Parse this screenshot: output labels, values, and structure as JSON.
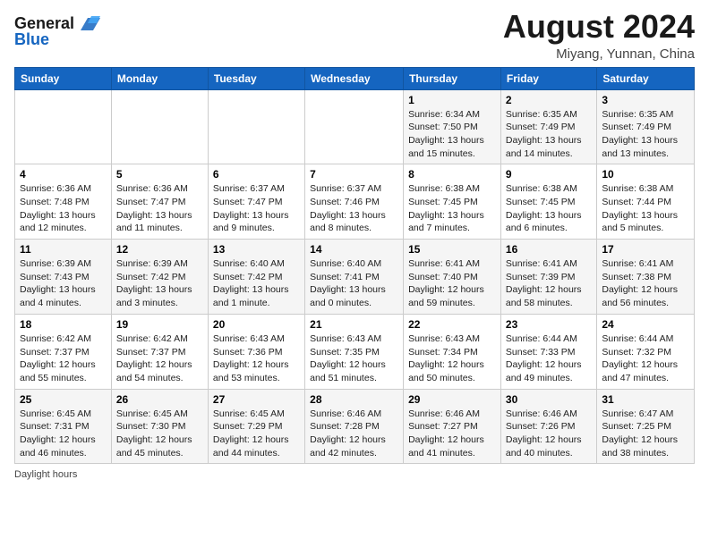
{
  "header": {
    "logo": {
      "line1": "General",
      "line2": "Blue"
    },
    "title": "August 2024",
    "location": "Miyang, Yunnan, China"
  },
  "calendar": {
    "days_of_week": [
      "Sunday",
      "Monday",
      "Tuesday",
      "Wednesday",
      "Thursday",
      "Friday",
      "Saturday"
    ],
    "weeks": [
      [
        {
          "day": "",
          "info": ""
        },
        {
          "day": "",
          "info": ""
        },
        {
          "day": "",
          "info": ""
        },
        {
          "day": "",
          "info": ""
        },
        {
          "day": "1",
          "info": "Sunrise: 6:34 AM\nSunset: 7:50 PM\nDaylight: 13 hours\nand 15 minutes."
        },
        {
          "day": "2",
          "info": "Sunrise: 6:35 AM\nSunset: 7:49 PM\nDaylight: 13 hours\nand 14 minutes."
        },
        {
          "day": "3",
          "info": "Sunrise: 6:35 AM\nSunset: 7:49 PM\nDaylight: 13 hours\nand 13 minutes."
        }
      ],
      [
        {
          "day": "4",
          "info": "Sunrise: 6:36 AM\nSunset: 7:48 PM\nDaylight: 13 hours\nand 12 minutes."
        },
        {
          "day": "5",
          "info": "Sunrise: 6:36 AM\nSunset: 7:47 PM\nDaylight: 13 hours\nand 11 minutes."
        },
        {
          "day": "6",
          "info": "Sunrise: 6:37 AM\nSunset: 7:47 PM\nDaylight: 13 hours\nand 9 minutes."
        },
        {
          "day": "7",
          "info": "Sunrise: 6:37 AM\nSunset: 7:46 PM\nDaylight: 13 hours\nand 8 minutes."
        },
        {
          "day": "8",
          "info": "Sunrise: 6:38 AM\nSunset: 7:45 PM\nDaylight: 13 hours\nand 7 minutes."
        },
        {
          "day": "9",
          "info": "Sunrise: 6:38 AM\nSunset: 7:45 PM\nDaylight: 13 hours\nand 6 minutes."
        },
        {
          "day": "10",
          "info": "Sunrise: 6:38 AM\nSunset: 7:44 PM\nDaylight: 13 hours\nand 5 minutes."
        }
      ],
      [
        {
          "day": "11",
          "info": "Sunrise: 6:39 AM\nSunset: 7:43 PM\nDaylight: 13 hours\nand 4 minutes."
        },
        {
          "day": "12",
          "info": "Sunrise: 6:39 AM\nSunset: 7:42 PM\nDaylight: 13 hours\nand 3 minutes."
        },
        {
          "day": "13",
          "info": "Sunrise: 6:40 AM\nSunset: 7:42 PM\nDaylight: 13 hours\nand 1 minute."
        },
        {
          "day": "14",
          "info": "Sunrise: 6:40 AM\nSunset: 7:41 PM\nDaylight: 13 hours\nand 0 minutes."
        },
        {
          "day": "15",
          "info": "Sunrise: 6:41 AM\nSunset: 7:40 PM\nDaylight: 12 hours\nand 59 minutes."
        },
        {
          "day": "16",
          "info": "Sunrise: 6:41 AM\nSunset: 7:39 PM\nDaylight: 12 hours\nand 58 minutes."
        },
        {
          "day": "17",
          "info": "Sunrise: 6:41 AM\nSunset: 7:38 PM\nDaylight: 12 hours\nand 56 minutes."
        }
      ],
      [
        {
          "day": "18",
          "info": "Sunrise: 6:42 AM\nSunset: 7:37 PM\nDaylight: 12 hours\nand 55 minutes."
        },
        {
          "day": "19",
          "info": "Sunrise: 6:42 AM\nSunset: 7:37 PM\nDaylight: 12 hours\nand 54 minutes."
        },
        {
          "day": "20",
          "info": "Sunrise: 6:43 AM\nSunset: 7:36 PM\nDaylight: 12 hours\nand 53 minutes."
        },
        {
          "day": "21",
          "info": "Sunrise: 6:43 AM\nSunset: 7:35 PM\nDaylight: 12 hours\nand 51 minutes."
        },
        {
          "day": "22",
          "info": "Sunrise: 6:43 AM\nSunset: 7:34 PM\nDaylight: 12 hours\nand 50 minutes."
        },
        {
          "day": "23",
          "info": "Sunrise: 6:44 AM\nSunset: 7:33 PM\nDaylight: 12 hours\nand 49 minutes."
        },
        {
          "day": "24",
          "info": "Sunrise: 6:44 AM\nSunset: 7:32 PM\nDaylight: 12 hours\nand 47 minutes."
        }
      ],
      [
        {
          "day": "25",
          "info": "Sunrise: 6:45 AM\nSunset: 7:31 PM\nDaylight: 12 hours\nand 46 minutes."
        },
        {
          "day": "26",
          "info": "Sunrise: 6:45 AM\nSunset: 7:30 PM\nDaylight: 12 hours\nand 45 minutes."
        },
        {
          "day": "27",
          "info": "Sunrise: 6:45 AM\nSunset: 7:29 PM\nDaylight: 12 hours\nand 44 minutes."
        },
        {
          "day": "28",
          "info": "Sunrise: 6:46 AM\nSunset: 7:28 PM\nDaylight: 12 hours\nand 42 minutes."
        },
        {
          "day": "29",
          "info": "Sunrise: 6:46 AM\nSunset: 7:27 PM\nDaylight: 12 hours\nand 41 minutes."
        },
        {
          "day": "30",
          "info": "Sunrise: 6:46 AM\nSunset: 7:26 PM\nDaylight: 12 hours\nand 40 minutes."
        },
        {
          "day": "31",
          "info": "Sunrise: 6:47 AM\nSunset: 7:25 PM\nDaylight: 12 hours\nand 38 minutes."
        }
      ]
    ]
  },
  "footer": {
    "text": "Daylight hours"
  }
}
